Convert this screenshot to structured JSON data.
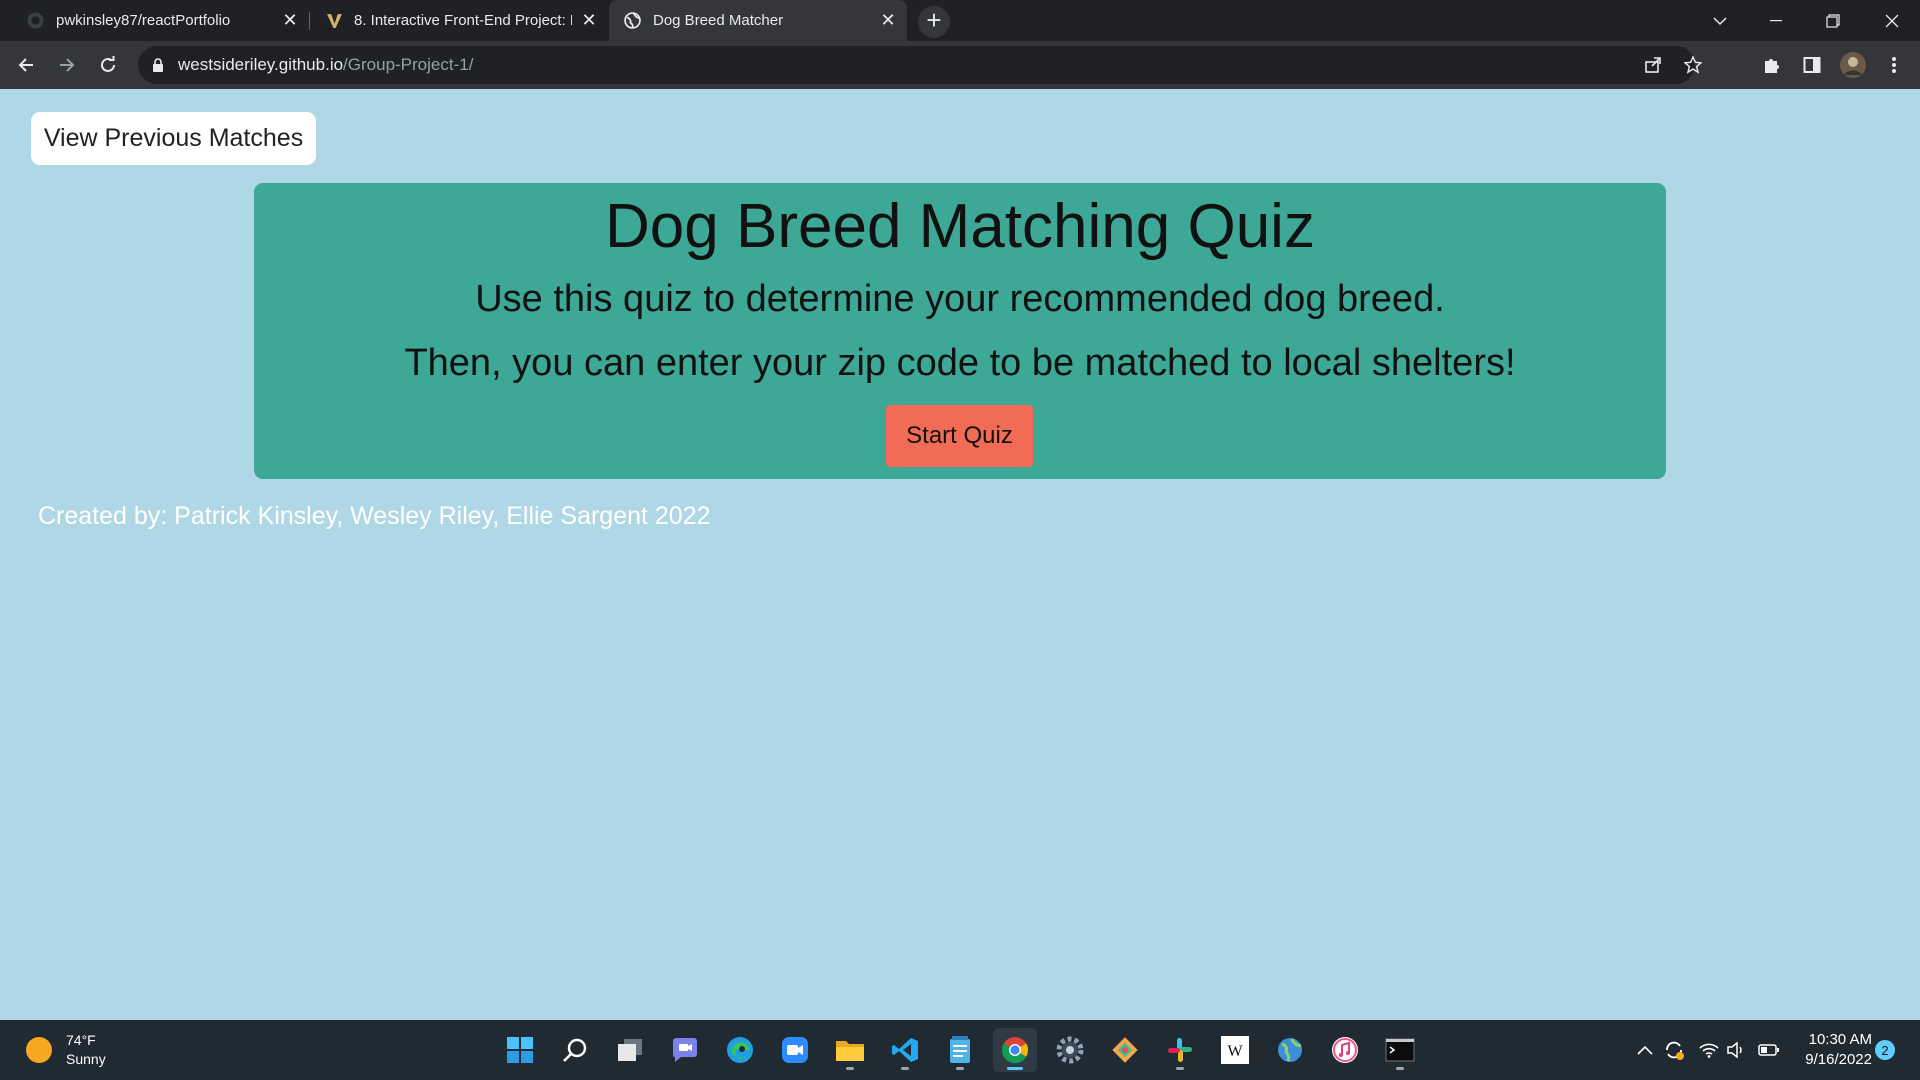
{
  "browser": {
    "tabs": [
      {
        "title": "pwkinsley87/reactPortfolio",
        "icon": "github-icon",
        "active": false
      },
      {
        "title": "8. Interactive Front-End Project: K",
        "icon": "vanderbilt-icon",
        "active": false
      },
      {
        "title": "Dog Breed Matcher",
        "icon": "globe-icon",
        "active": true
      }
    ],
    "url_host": "westsideriley.github.io",
    "url_path": "/Group-Project-1/"
  },
  "page": {
    "view_previous_label": "View Previous Matches",
    "title": "Dog Breed Matching Quiz",
    "intro_line1": "Use this quiz to determine your recommended dog breed.",
    "intro_line2": "Then, you can enter your zip code to be matched to local shelters!",
    "start_label": "Start Quiz",
    "credits": "Created by: Patrick Kinsley, Wesley Riley, Ellie Sargent 2022"
  },
  "colors": {
    "page_bg": "#b0d7e6",
    "card_bg": "#3da896",
    "start_button": "#f26b55"
  },
  "taskbar": {
    "weather_temp": "74°F",
    "weather_cond": "Sunny",
    "time": "10:30 AM",
    "date": "9/16/2022",
    "notification_count": "2",
    "apps": [
      "windows-start-icon",
      "search-icon",
      "task-view-icon",
      "teams-chat-icon",
      "edge-icon",
      "zoom-icon",
      "file-explorer-icon",
      "vscode-icon",
      "notepad-icon",
      "chrome-icon",
      "settings-icon",
      "git-icon",
      "slack-icon",
      "wikipedia-icon",
      "browser-globe-icon",
      "itunes-icon",
      "terminal-icon"
    ]
  }
}
